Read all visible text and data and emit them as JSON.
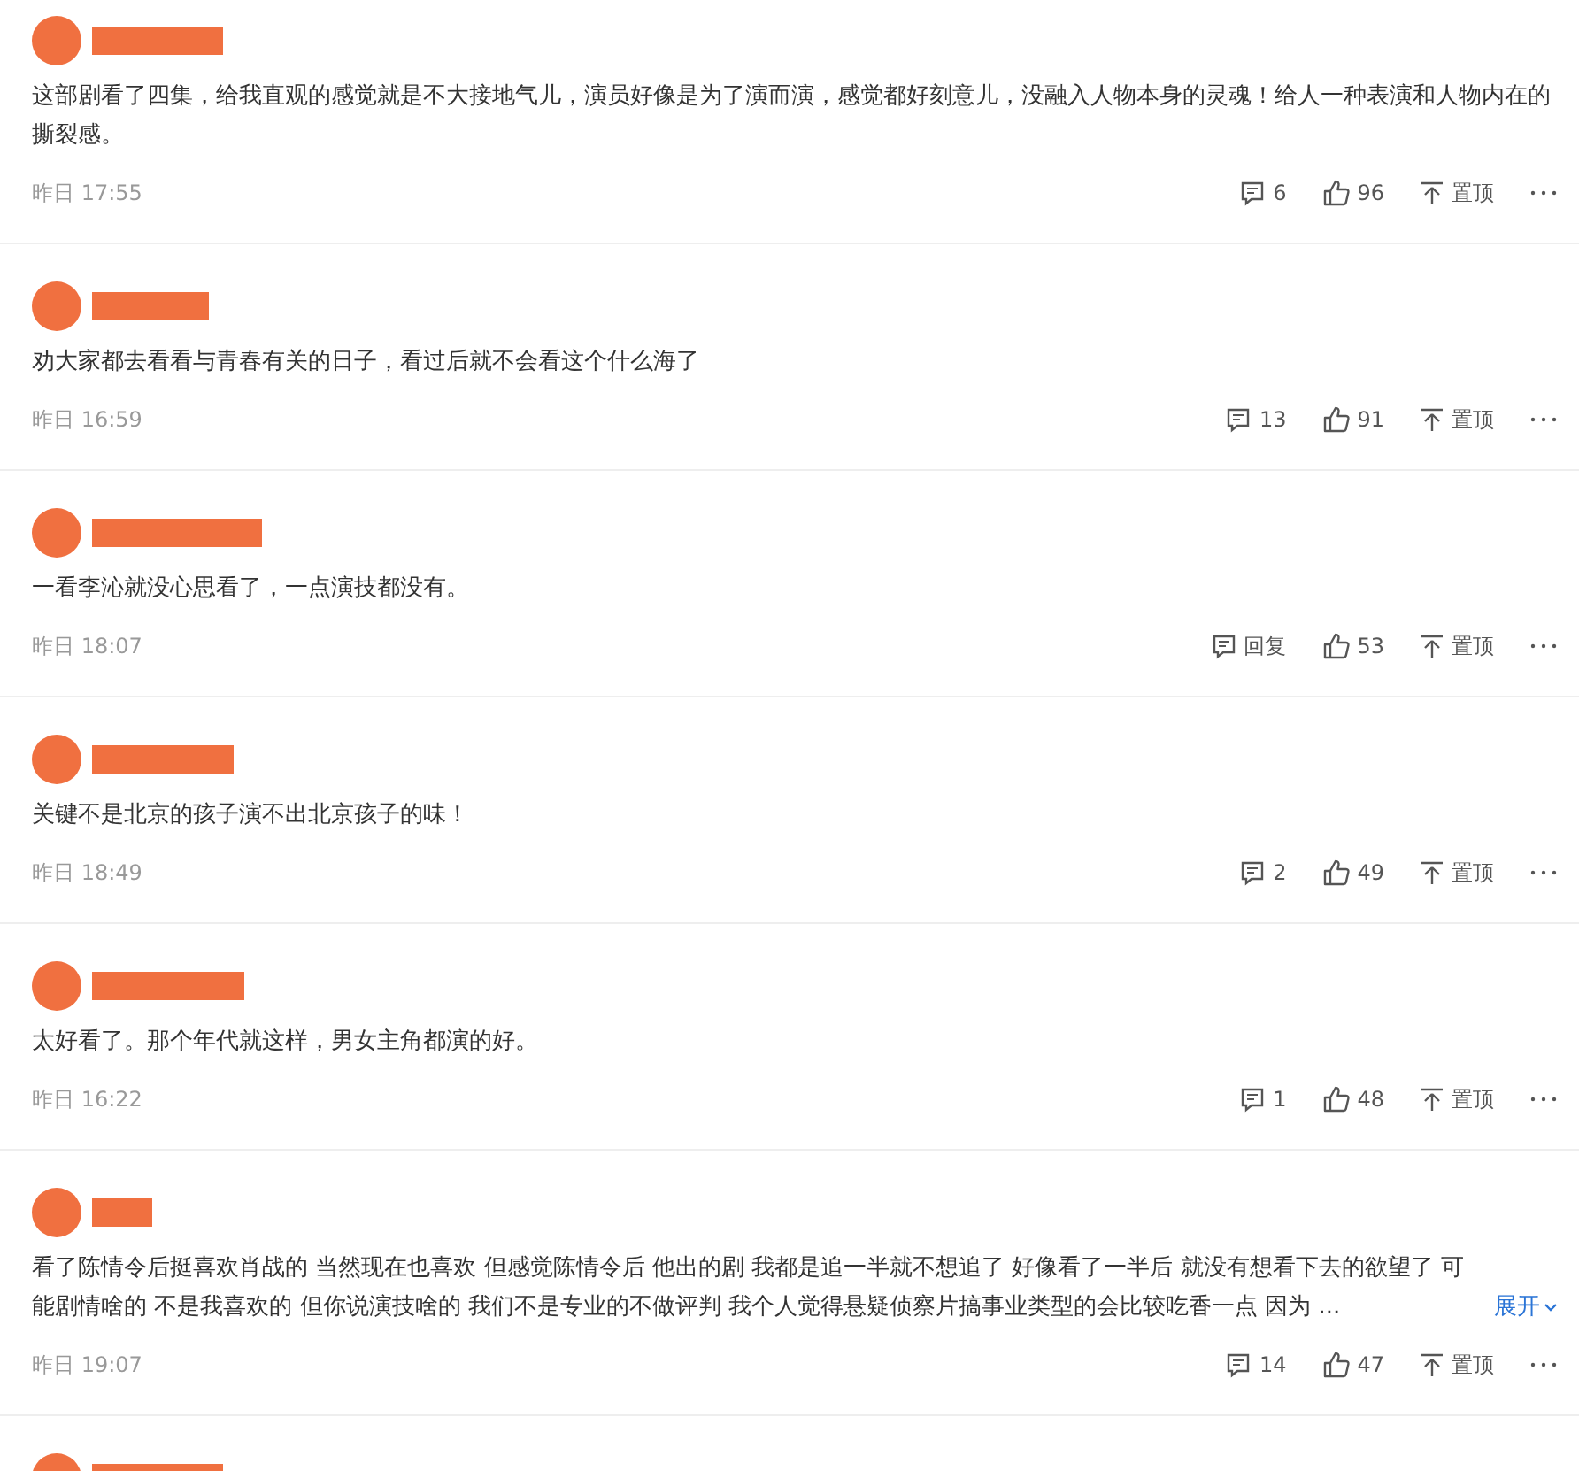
{
  "comments": [
    {
      "author": {
        "redacted": true
      },
      "text": "这部剧看了四集，给我直观的感觉就是不大接地气儿，演员好像是为了演而演，感觉都好刻意儿，没融入人物本身的灵魂！给人一种表演和人物内在的撕裂感。",
      "time": "昨日 17:55",
      "replies": "6",
      "likes": "96",
      "pin": "置顶"
    },
    {
      "author": {
        "redacted": true
      },
      "text": "劝大家都去看看与青春有关的日子，看过后就不会看这个什么海了",
      "time": "昨日 16:59",
      "replies": "13",
      "likes": "91",
      "pin": "置顶"
    },
    {
      "author": {
        "redacted": true
      },
      "text": "一看李沁就没心思看了，一点演技都没有。",
      "time": "昨日 18:07",
      "replies": "回复",
      "likes": "53",
      "pin": "置顶"
    },
    {
      "author": {
        "redacted": true
      },
      "text": "关键不是北京的孩子演不出北京孩子的味！",
      "time": "昨日 18:49",
      "replies": "2",
      "likes": "49",
      "pin": "置顶"
    },
    {
      "author": {
        "redacted": true
      },
      "text": "太好看了。那个年代就这样，男女主角都演的好。",
      "time": "昨日 16:22",
      "replies": "1",
      "likes": "48",
      "pin": "置顶"
    },
    {
      "author": {
        "redacted": true
      },
      "text": "看了陈情令后挺喜欢肖战的 当然现在也喜欢 但感觉陈情令后 他出的剧 我都是追一半就不想追了 好像看了一半后 就没有想看下去的欲望了 可能剧情啥的 不是我喜欢的 但你说演技啥的 我们不是专业的不做评判 我个人觉得悬疑侦察片搞事业类型的会比较吃香一点 因为 ...",
      "expand": "展开",
      "time": "昨日 19:07",
      "replies": "14",
      "likes": "47",
      "pin": "置顶"
    },
    {
      "author": {
        "redacted": true
      }
    }
  ]
}
